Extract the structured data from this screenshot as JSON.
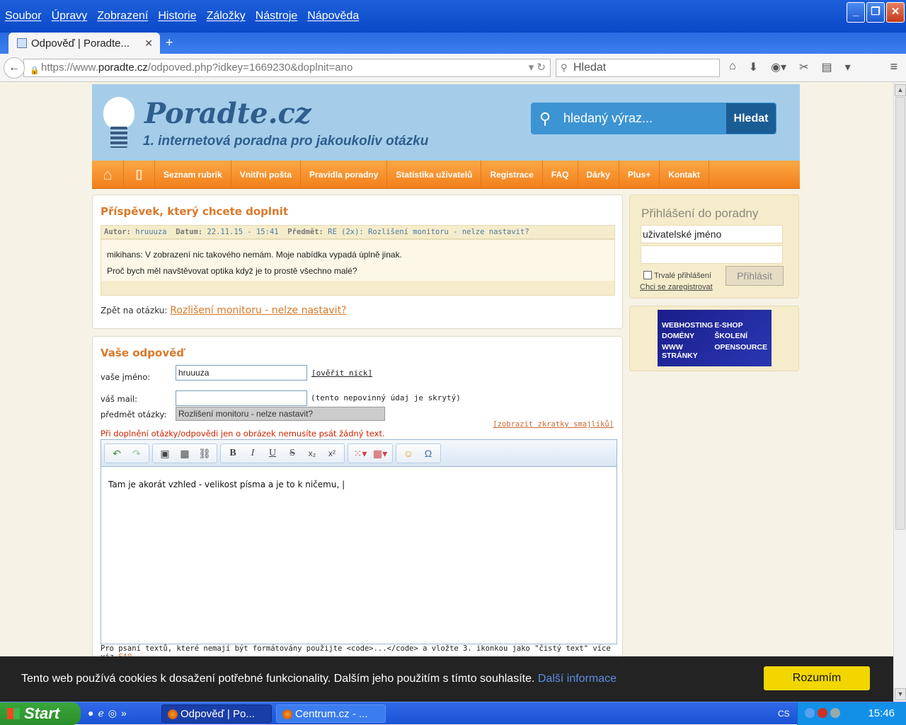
{
  "browser": {
    "menu": [
      "Soubor",
      "Úpravy",
      "Zobrazení",
      "Historie",
      "Záložky",
      "Nástroje",
      "Nápověda"
    ],
    "tab_title": "Odpověď | Poradte...",
    "url_prefix": "https://www.",
    "url_host": "poradte.cz",
    "url_path": "/odpoved.php?idkey=1669230&doplnit=ano",
    "search_placeholder": "Hledat"
  },
  "header": {
    "logo": "Poradte.cz",
    "tagline": "1. internetová poradna pro jakoukoliv otázku",
    "search_placeholder": "hledaný výraz...",
    "search_button": "Hledat"
  },
  "nav": [
    "Seznam rubrik",
    "Vnitřní pošta",
    "Pravidla poradny",
    "Statistika uživatelů",
    "Registrace",
    "FAQ",
    "Dárky",
    "Plus+",
    "Kontakt"
  ],
  "post": {
    "heading": "Příspěvek, který chcete doplnit",
    "author_label": "Autor:",
    "author": "hruuuza",
    "date_label": "Datum:",
    "date": "22.11.15 - 15:41",
    "subject_label": "Předmět:",
    "subject": "RE (2x): Rozlišení monitoru - nelze nastavit?",
    "line1": "mikihans: V zobrazení nic takového nemám. Moje nabídka vypadá úplně jinak.",
    "line2": "Proč bych měl navštěvovat optika když je to prostě všechno malé?",
    "back_label": "Zpět na otázku:",
    "back_link": "Rozlišení monitoru - nelze nastavit?"
  },
  "reply": {
    "heading": "Vaše odpověď",
    "name_label": "vaše jméno:",
    "name_value": "hruuuza",
    "verify": "[ověřit nick]",
    "mail_label": "váš mail:",
    "mail_note": "(tento nepovinný údaj je skrytý)",
    "subject_label": "předmět otázky:",
    "subject_value": "Rozlišení monitoru - nelze nastavit?",
    "smileys": "[zobrazit zkratky smajlíků]",
    "red_note": "Při doplnění otázky/odpovědi jen o obrázek nemusíte psát žádný text.",
    "editor_text": "Tam je akorát vzhled - velikost písma a je to k ničemu, |",
    "footer_note": "Pro psaní textů, které nemají být formátovány použijte <code>...</code> a vložte 3. ikonkou jako \"čistý text\" více viz",
    "footer_link": "FAQ"
  },
  "login": {
    "title": "Přihlášení do poradny",
    "username_placeholder": "uživatelské jméno",
    "remember": "Trvalé přihlášení",
    "register": "Chci se zaregistrovat",
    "button": "Přihlásit"
  },
  "ad": [
    "WEBHOSTING",
    "E-SHOP",
    "DOMÉNY",
    "ŠKOLENÍ",
    "WWW STRÁNKY",
    "OPENSOURCE"
  ],
  "cookie": {
    "text": "Tento web používá cookies k dosažení potřebné funkcionality. Dalším jeho použitím s tímto souhlasíte.",
    "link": "Další informace",
    "button": "Rozumím"
  },
  "taskbar": {
    "start": "Start",
    "task1": "Odpověď | Po...",
    "task2": "Centrum.cz - ...",
    "lang": "CS",
    "clock": "15:46"
  }
}
